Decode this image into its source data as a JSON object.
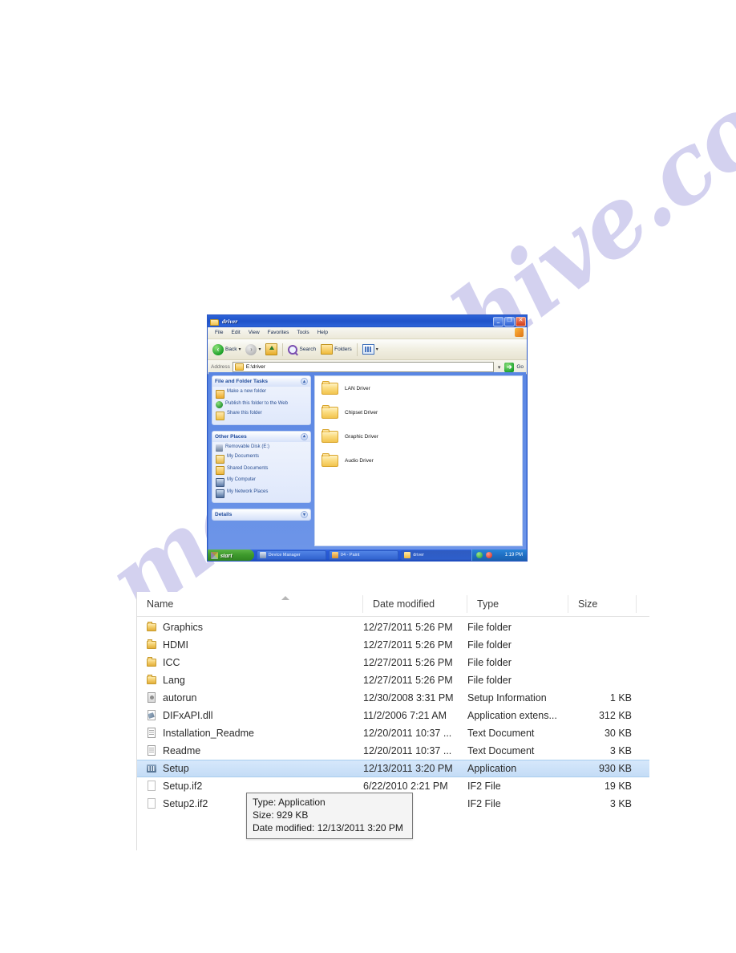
{
  "watermark": {
    "text": "manualshive.com"
  },
  "xp_window": {
    "title": "driver",
    "window_buttons": {
      "minimize": "_",
      "maximize": "❐",
      "close": "✕"
    },
    "menu": [
      "File",
      "Edit",
      "View",
      "Favorites",
      "Tools",
      "Help"
    ],
    "toolbar": {
      "back": "Back",
      "forward": "",
      "up": "",
      "search": "Search",
      "folders": "Folders",
      "views": ""
    },
    "address": {
      "label": "Address",
      "value": "E:\\driver",
      "go_label": "Go"
    },
    "sidebar": {
      "panels": [
        {
          "title": "File and Folder Tasks",
          "items": [
            {
              "label": "Make a new folder",
              "icon": "new-folder-icon"
            },
            {
              "label": "Publish this folder to the Web",
              "icon": "publish-web-icon"
            },
            {
              "label": "Share this folder",
              "icon": "share-folder-icon"
            }
          ]
        },
        {
          "title": "Other Places",
          "items": [
            {
              "label": "Removable Disk (E:)",
              "icon": "removable-disk-icon"
            },
            {
              "label": "My Documents",
              "icon": "my-documents-icon"
            },
            {
              "label": "Shared Documents",
              "icon": "shared-documents-icon"
            },
            {
              "label": "My Computer",
              "icon": "my-computer-icon"
            },
            {
              "label": "My Network Places",
              "icon": "my-network-places-icon"
            }
          ]
        },
        {
          "title": "Details",
          "items": []
        }
      ]
    },
    "folders": [
      {
        "name": "LAN Driver"
      },
      {
        "name": "Chipset Driver"
      },
      {
        "name": "Graphic Driver"
      },
      {
        "name": "Audio Driver"
      }
    ],
    "taskbar": {
      "start_label": "start",
      "tasks": [
        {
          "label": "Device Manager",
          "icon": "device-manager-icon"
        },
        {
          "label": "04 - Paint",
          "icon": "paint-icon"
        },
        {
          "label": "driver",
          "icon": "folder-icon"
        }
      ],
      "tray": {
        "time": "1:19 PM"
      }
    }
  },
  "win7_explorer": {
    "columns": [
      "Name",
      "Date modified",
      "Type",
      "Size"
    ],
    "rows": [
      {
        "name": "Graphics",
        "date": "12/27/2011 5:26 PM",
        "type": "File folder",
        "size": "",
        "icon": "folder-icon",
        "selected": false
      },
      {
        "name": "HDMI",
        "date": "12/27/2011 5:26 PM",
        "type": "File folder",
        "size": "",
        "icon": "folder-icon",
        "selected": false
      },
      {
        "name": "ICC",
        "date": "12/27/2011 5:26 PM",
        "type": "File folder",
        "size": "",
        "icon": "folder-icon",
        "selected": false
      },
      {
        "name": "Lang",
        "date": "12/27/2011 5:26 PM",
        "type": "File folder",
        "size": "",
        "icon": "folder-icon",
        "selected": false
      },
      {
        "name": "autorun",
        "date": "12/30/2008 3:31 PM",
        "type": "Setup Information",
        "size": "1 KB",
        "icon": "setup-information-icon",
        "selected": false
      },
      {
        "name": "DIFxAPI.dll",
        "date": "11/2/2006 7:21 AM",
        "type": "Application extens...",
        "size": "312 KB",
        "icon": "dll-icon",
        "selected": false
      },
      {
        "name": "Installation_Readme",
        "date": "12/20/2011 10:37 ...",
        "type": "Text Document",
        "size": "30 KB",
        "icon": "text-document-icon",
        "selected": false
      },
      {
        "name": "Readme",
        "date": "12/20/2011 10:37 ...",
        "type": "Text Document",
        "size": "3 KB",
        "icon": "text-document-icon",
        "selected": false
      },
      {
        "name": "Setup",
        "date": "12/13/2011 3:20 PM",
        "type": "Application",
        "size": "930 KB",
        "icon": "application-icon",
        "selected": true
      },
      {
        "name": "Setup.if2",
        "date": "6/22/2010 2:21 PM",
        "type": "IF2 File",
        "size": "19 KB",
        "icon": "blank-file-icon",
        "selected": false
      },
      {
        "name": "Setup2.if2",
        "date": "9 2:15 PM",
        "type": "IF2 File",
        "size": "3 KB",
        "icon": "blank-file-icon",
        "selected": false
      }
    ],
    "tooltip": {
      "line1": "Type: Application",
      "line2": "Size: 929 KB",
      "line3": "Date modified: 12/13/2011 3:20 PM"
    }
  },
  "colors": {
    "xp_title_blue": "#1f52c9",
    "xp_desktop_blue": "#5a86e3",
    "selection_blue": "#c4dcf6",
    "folder_yellow": "#f3ce6d",
    "watermark_purple": "#b9b6e6"
  }
}
